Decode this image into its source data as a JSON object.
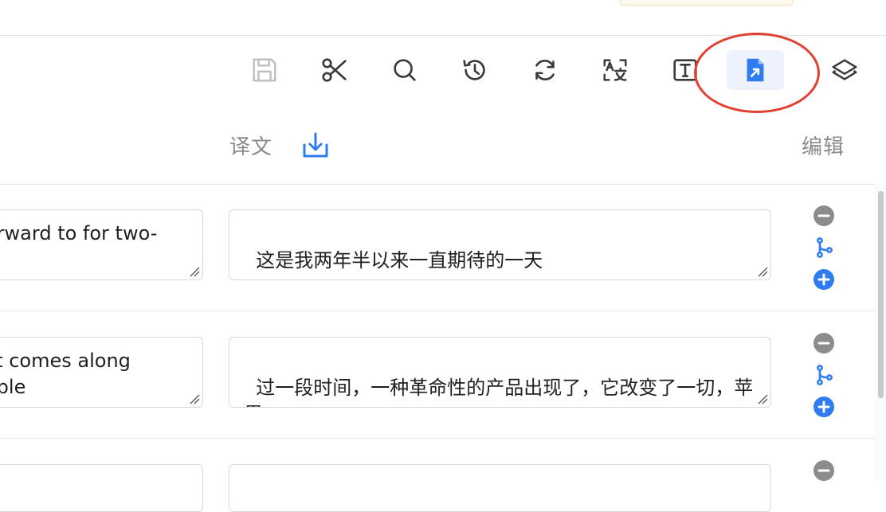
{
  "colors": {
    "accent_blue": "#2f7bf0",
    "icon_gray": "#3a3a3a",
    "icon_disabled": "#bfbfbf",
    "annotation_red": "#e0402f",
    "remove_gray": "#8c8c8c"
  },
  "toolbar": {
    "buttons": [
      {
        "name": "save-icon",
        "state": "disabled"
      },
      {
        "name": "scissors-icon",
        "state": "normal"
      },
      {
        "name": "search-icon",
        "state": "normal"
      },
      {
        "name": "history-icon",
        "state": "normal"
      },
      {
        "name": "refresh-icon",
        "state": "normal"
      },
      {
        "name": "translate-icon",
        "state": "normal"
      },
      {
        "name": "text-box-icon",
        "state": "normal"
      },
      {
        "name": "export-file-icon",
        "state": "active"
      },
      {
        "name": "layers-icon",
        "state": "normal"
      }
    ]
  },
  "columns": {
    "translation_label": "译文",
    "edit_label": "编辑"
  },
  "rows": [
    {
      "source": "orward to for two-",
      "target": "这是我两年半以来一直期待的一天"
    },
    {
      "source": "ct comes along\nople",
      "target": "过一段时间，一种革命性的产品出现了，它改变了一切，苹果"
    },
    {
      "source": "",
      "target": ""
    }
  ]
}
